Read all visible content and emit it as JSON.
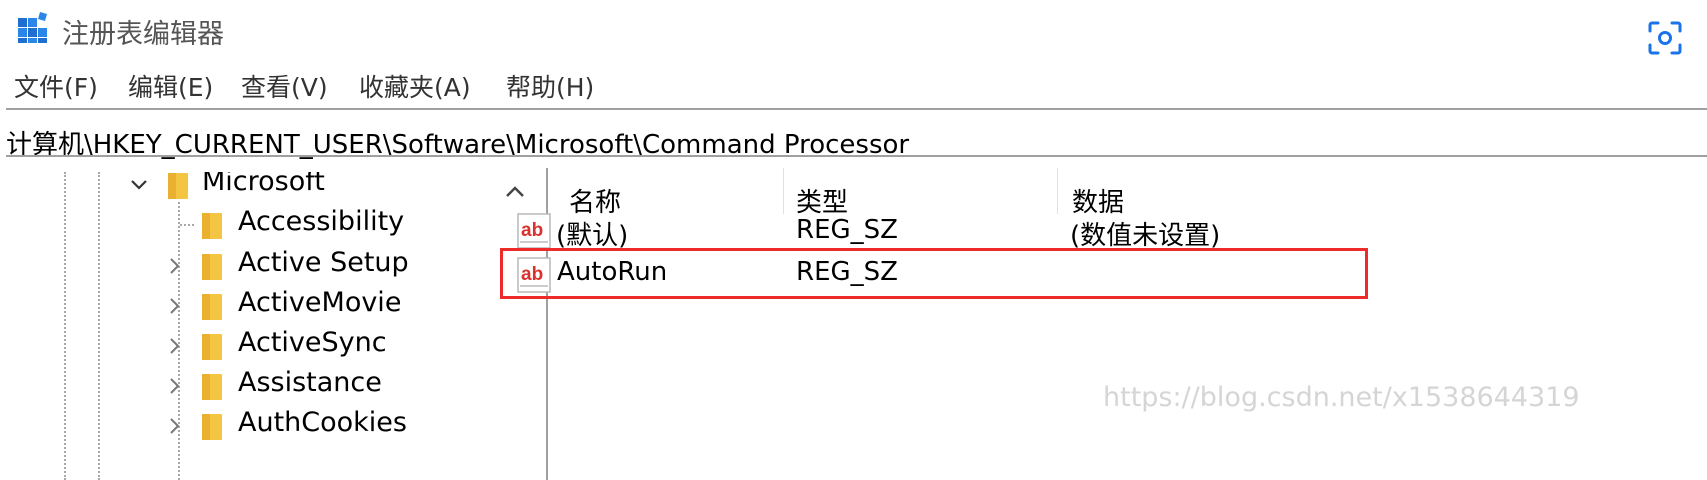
{
  "window": {
    "title": "注册表编辑器"
  },
  "icons": {
    "app": "registry-editor-icon",
    "screenshot": "screenshot-tool-icon"
  },
  "menu": [
    "文件(F)",
    "编辑(E)",
    "查看(V)",
    "收藏夹(A)",
    "帮助(H)"
  ],
  "address": "计算机\\HKEY_CURRENT_USER\\Software\\Microsoft\\Command Processor",
  "tree": {
    "parent": {
      "label": "Microsoft",
      "expanded": true
    },
    "children": [
      {
        "label": "Accessibility",
        "expandable": false
      },
      {
        "label": "Active Setup",
        "expandable": true
      },
      {
        "label": "ActiveMovie",
        "expandable": true
      },
      {
        "label": "ActiveSync",
        "expandable": true
      },
      {
        "label": "Assistance",
        "expandable": true
      },
      {
        "label": "AuthCookies",
        "expandable": true
      }
    ]
  },
  "list": {
    "headers": {
      "name": "名称",
      "type": "类型",
      "data": "数据"
    },
    "rows": [
      {
        "name": "(默认)",
        "type": "REG_SZ",
        "data": "(数值未设置)",
        "highlighted": false
      },
      {
        "name": "AutoRun",
        "type": "REG_SZ",
        "data": "",
        "highlighted": true
      }
    ]
  },
  "colors": {
    "highlight": "#ee2b2b",
    "folder": "#f4c542",
    "ab_icon": "#d9322e"
  },
  "watermark": "https://blog.csdn.net/x1538644319"
}
